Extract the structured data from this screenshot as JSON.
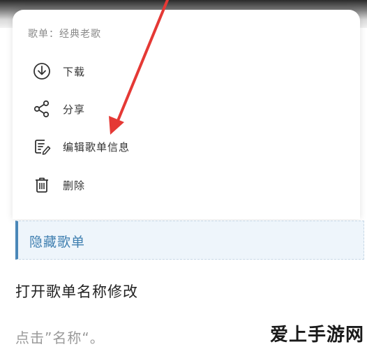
{
  "sheet": {
    "header": "歌单：经典老歌",
    "items": [
      {
        "label": "下载",
        "icon": "download-icon"
      },
      {
        "label": "分享",
        "icon": "share-icon"
      },
      {
        "label": "编辑歌单信息",
        "icon": "edit-icon"
      },
      {
        "label": "删除",
        "icon": "trash-icon"
      }
    ]
  },
  "hidden_playlist": {
    "label": "隐藏歌单"
  },
  "article": {
    "heading": "打开歌单名称修改",
    "hint": "点击”名称“。"
  },
  "watermark": "爱上手游网",
  "colors": {
    "arrow": "#e53935",
    "accent": "#3f7fb0",
    "hidden_bg": "#eef5fb"
  }
}
